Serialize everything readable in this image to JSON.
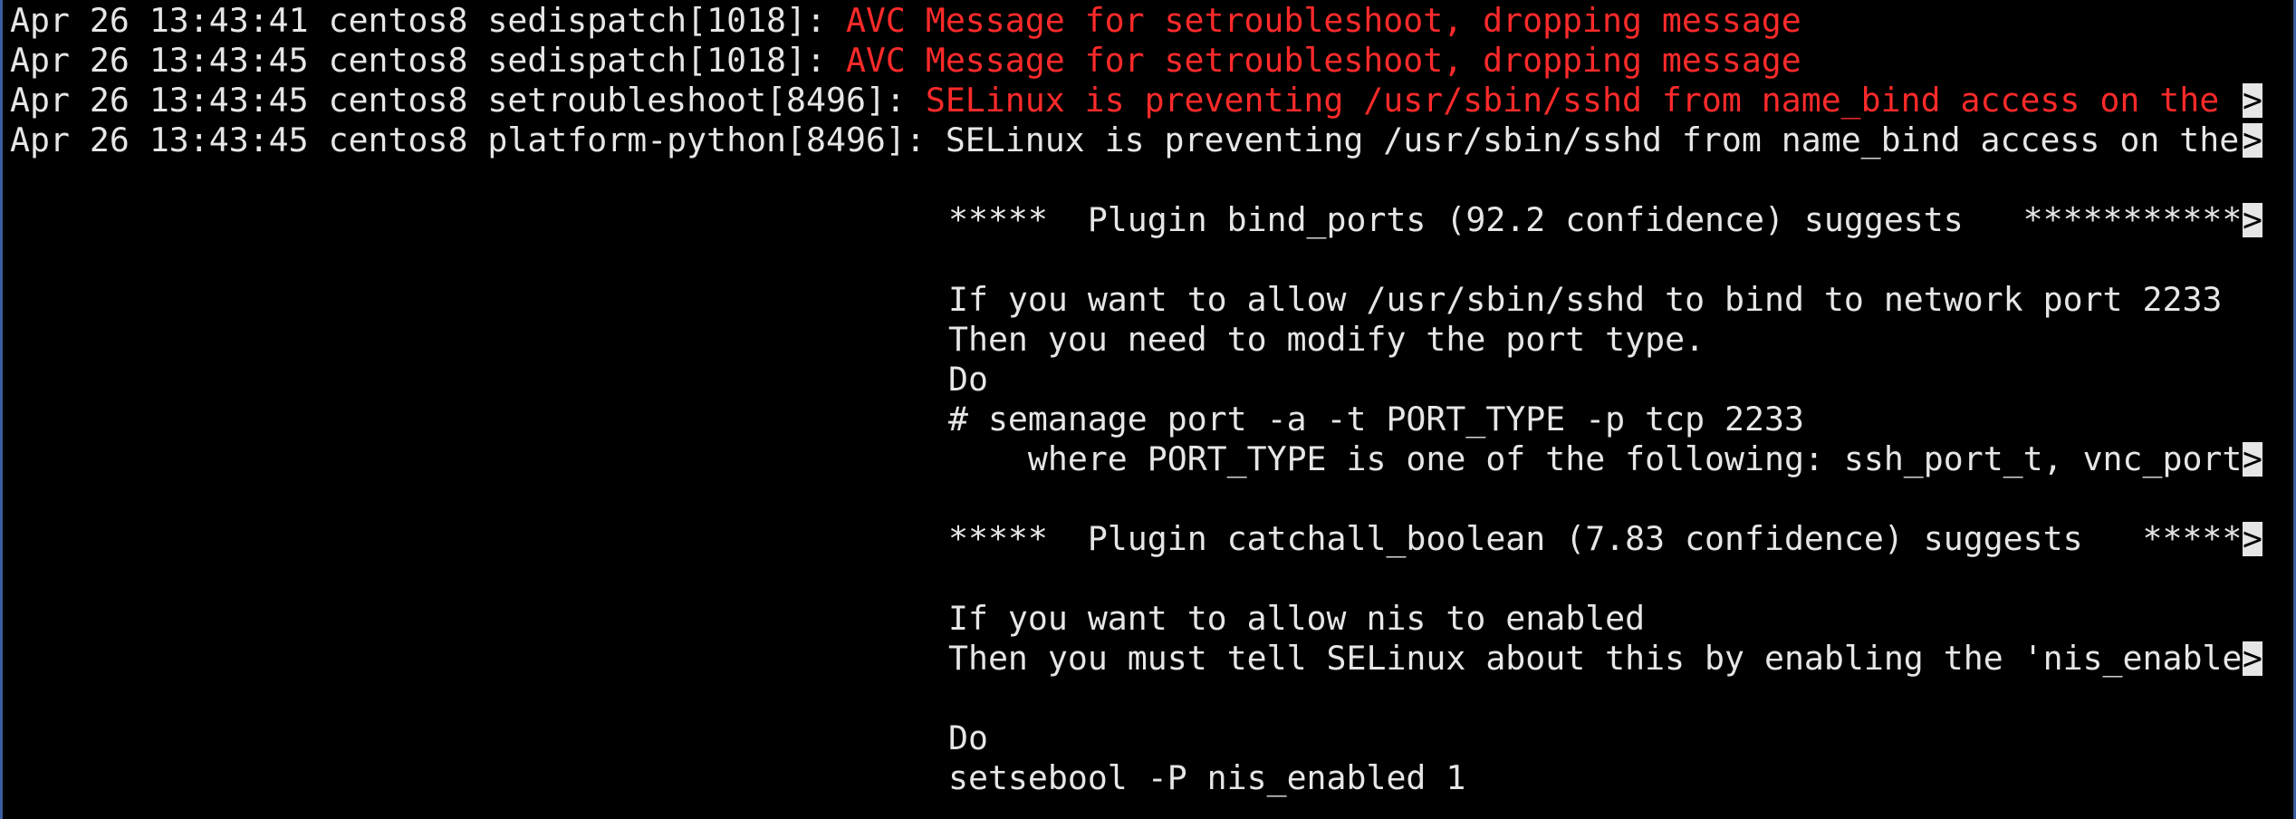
{
  "terminal": {
    "lines": [
      {
        "prefix": "Apr 26 13:43:41 centos8 sedispatch[1018]: ",
        "message": "AVC Message for setroubleshoot, dropping message",
        "truncated": false
      },
      {
        "prefix": "Apr 26 13:43:45 centos8 sedispatch[1018]: ",
        "message": "AVC Message for setroubleshoot, dropping message",
        "truncated": false
      },
      {
        "prefix": "Apr 26 13:43:45 centos8 setroubleshoot[8496]: ",
        "message": "SELinux is preventing /usr/sbin/sshd from name_bind access on the ",
        "truncated": true
      },
      {
        "prefix": "Apr 26 13:43:45 centos8 platform-python[8496]: ",
        "message": "SELinux is preventing /usr/sbin/sshd from name_bind access on the",
        "truncated": true
      }
    ],
    "detail": [
      {
        "text": "",
        "truncated": false
      },
      {
        "text": "*****  Plugin bind_ports (92.2 confidence) suggests   ***********",
        "truncated": true
      },
      {
        "text": "",
        "truncated": false
      },
      {
        "text": "If you want to allow /usr/sbin/sshd to bind to network port 2233",
        "truncated": false
      },
      {
        "text": "Then you need to modify the port type.",
        "truncated": false
      },
      {
        "text": "Do",
        "truncated": false
      },
      {
        "text": "# semanage port -a -t PORT_TYPE -p tcp 2233",
        "truncated": false
      },
      {
        "text": "    where PORT_TYPE is one of the following: ssh_port_t, vnc_port",
        "truncated": true
      },
      {
        "text": "",
        "truncated": false
      },
      {
        "text": "*****  Plugin catchall_boolean (7.83 confidence) suggests   *****",
        "truncated": true
      },
      {
        "text": "",
        "truncated": false
      },
      {
        "text": "If you want to allow nis to enabled",
        "truncated": false
      },
      {
        "text": "Then you must tell SELinux about this by enabling the 'nis_enable",
        "truncated": true
      },
      {
        "text": "",
        "truncated": false
      },
      {
        "text": "Do",
        "truncated": false
      },
      {
        "text": "setsebool -P nis_enabled 1",
        "truncated": false
      }
    ],
    "truncation_marker": ">",
    "colors": {
      "background": "#000000",
      "foreground": "#e6e6e6",
      "error": "#ff2a2a",
      "border": "#3a5fa0"
    }
  }
}
